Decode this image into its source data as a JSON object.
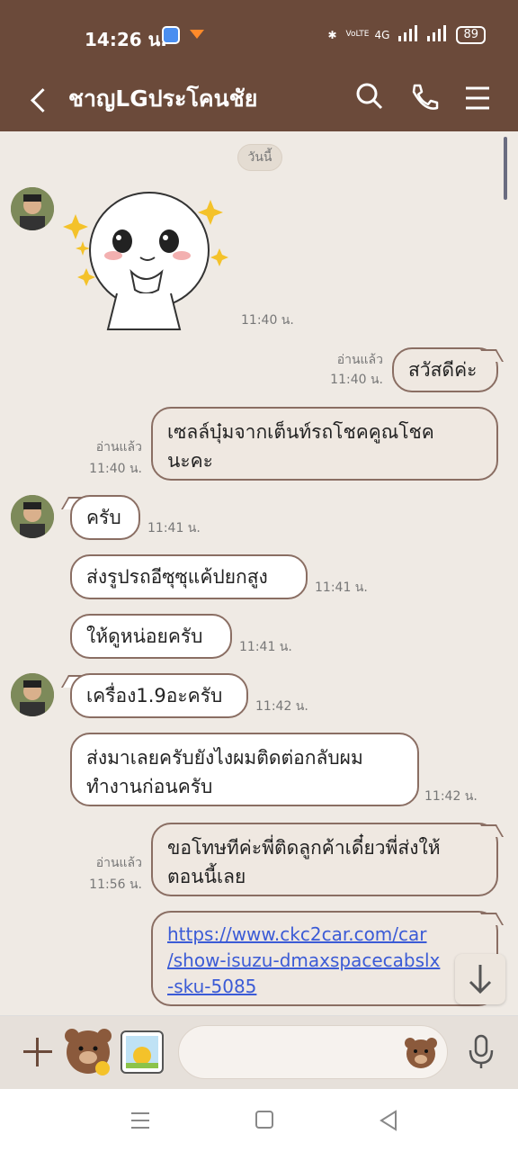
{
  "status": {
    "time": "14:26 น.",
    "battery": "89",
    "volte": "VoLTE",
    "network": "4G"
  },
  "header": {
    "title": "ชาญLGประโคนชัย"
  },
  "chat": {
    "date_label": "วันนี้",
    "messages": [
      {
        "time": "11:40 น."
      },
      {
        "text": "สวัสดีค่ะ",
        "read": "อ่านแล้ว",
        "time": "11:40 น."
      },
      {
        "text": "เซลล์บุ๋มจากเต็นท์รถโชคคูณโชคนะคะ",
        "line1": "เซลล์บุ๋มจากเต็นท์รถโชคคูณโชค",
        "line2": "นะคะ",
        "read": "อ่านแล้ว",
        "time": "11:40 น."
      },
      {
        "text": "ครับ",
        "time": "11:41 น."
      },
      {
        "text": "ส่งรูปรถอีซุซุแค้ปยกสูง",
        "time": "11:41 น."
      },
      {
        "text": "ให้ดูหน่อยครับ",
        "time": "11:41 น."
      },
      {
        "text": "เครื่อง1.9อะครับ",
        "time": "11:42 น."
      },
      {
        "line1": "ส่งมาเลยครับยังไงผมติดต่อกลับผม",
        "line2": "ทำงานก่อนครับ",
        "time": "11:42 น."
      },
      {
        "line1": "ขอโทษทีค่ะพี่ติดลูกค้าเดี๋ยวพี่ส่งให้",
        "line2": "ตอนนี้เลย",
        "read": "อ่านแล้ว",
        "time": "11:56 น."
      },
      {
        "line1": "https://www.ckc2car.com/car",
        "line2": "/show-isuzu-dmaxspacecabslx",
        "line3": "-sku-5085"
      }
    ]
  },
  "input": {
    "placeholder": ""
  }
}
